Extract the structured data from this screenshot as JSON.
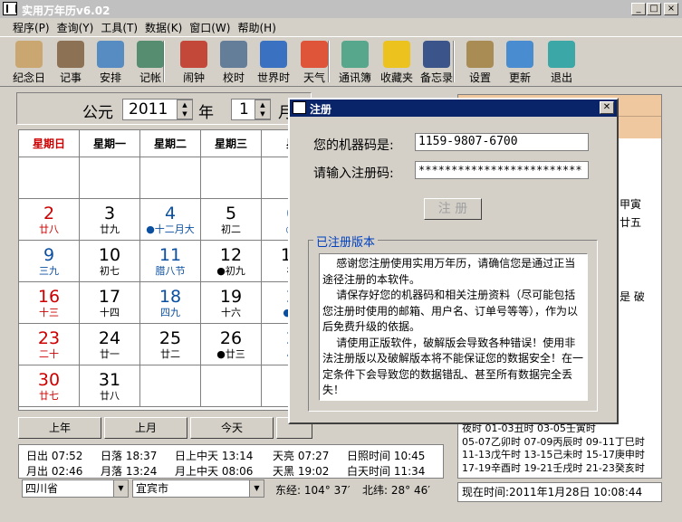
{
  "window": {
    "title": "实用万年历v6.02",
    "min": "_",
    "max": "□",
    "close": "×"
  },
  "menu": [
    "程序(P)",
    "查询(Y)",
    "工具(T)",
    "数据(K)",
    "窗口(W)",
    "帮助(H)"
  ],
  "toolbar": [
    {
      "label": "纪念日",
      "icon": "memorial-icon",
      "color": "#c8a060"
    },
    {
      "label": "记事",
      "icon": "notes-icon",
      "color": "#806040"
    },
    {
      "label": "安排",
      "icon": "schedule-icon",
      "color": "#4080c0"
    },
    {
      "label": "记帐",
      "icon": "ledger-icon",
      "color": "#408060"
    },
    {
      "label": "闹钟",
      "icon": "alarm-clock-icon",
      "color": "#c03020"
    },
    {
      "label": "校时",
      "icon": "time-sync-icon",
      "color": "#507090"
    },
    {
      "label": "世界时",
      "icon": "globe-icon",
      "color": "#2060c0"
    },
    {
      "label": "天气",
      "icon": "weather-icon",
      "color": "#e04020"
    },
    {
      "label": "通讯簿",
      "icon": "addressbook-icon",
      "color": "#40a080"
    },
    {
      "label": "收藏夹",
      "icon": "star-icon",
      "color": "#f0c000"
    },
    {
      "label": "备忘录",
      "icon": "memo-icon",
      "color": "#204080"
    },
    {
      "label": "设置",
      "icon": "settings-icon",
      "color": "#a08040"
    },
    {
      "label": "更新",
      "icon": "update-icon",
      "color": "#3080d0"
    },
    {
      "label": "退出",
      "icon": "exit-icon",
      "color": "#20a0a0"
    }
  ],
  "selector": {
    "era": "公元",
    "year": "2011",
    "year_unit": "年",
    "month": "1",
    "month_unit": "月"
  },
  "weekdays": [
    "星期日",
    "星期一",
    "星期二",
    "星期三",
    "星"
  ],
  "calendar": [
    [
      {
        "d": "",
        "l": ""
      },
      {
        "d": "",
        "l": ""
      },
      {
        "d": "",
        "l": ""
      },
      {
        "d": "",
        "l": ""
      },
      {
        "d": "",
        "l": ""
      }
    ],
    [
      {
        "d": "2",
        "l": "廿八",
        "c": "red"
      },
      {
        "d": "3",
        "l": "廿九"
      },
      {
        "d": "4",
        "l": "●十二月大",
        "c": "blue"
      },
      {
        "d": "5",
        "l": "初二"
      },
      {
        "d": "6",
        "l": "◎·",
        "c": "blue"
      }
    ],
    [
      {
        "d": "9",
        "l": "三九",
        "c": "blue"
      },
      {
        "d": "10",
        "l": "初七"
      },
      {
        "d": "11",
        "l": "腊八节",
        "c": "blue"
      },
      {
        "d": "12",
        "l": "●初九"
      },
      {
        "d": "13",
        "l": "初"
      }
    ],
    [
      {
        "d": "16",
        "l": "十三",
        "c": "red"
      },
      {
        "d": "17",
        "l": "十四"
      },
      {
        "d": "18",
        "l": "四九",
        "c": "blue"
      },
      {
        "d": "19",
        "l": "十六"
      },
      {
        "d": "2",
        "l": "●◎",
        "c": "blue"
      }
    ],
    [
      {
        "d": "23",
        "l": "二十",
        "c": "red"
      },
      {
        "d": "24",
        "l": "廿一"
      },
      {
        "d": "25",
        "l": "廿二"
      },
      {
        "d": "26",
        "l": "●廿三"
      },
      {
        "d": "2",
        "l": "小",
        "c": "blue"
      }
    ],
    [
      {
        "d": "30",
        "l": "廿七",
        "c": "red"
      },
      {
        "d": "31",
        "l": "廿八"
      },
      {
        "d": "",
        "l": ""
      },
      {
        "d": "",
        "l": ""
      },
      {
        "d": "",
        "l": ""
      }
    ]
  ],
  "nav": [
    "上年",
    "上月",
    "今天"
  ],
  "sun": {
    "rise": "日出 07:52",
    "set": "日落 18:37",
    "noon": "日上中天 13:14",
    "dawn": "天亮 07:27",
    "daylight": "日照时间 10:45"
  },
  "moon": {
    "rise": "月出 02:46",
    "set": "月落 13:24",
    "noon": "月上中天 08:06",
    "dusk": "天黑 19:02",
    "night": "白天时间 11:34"
  },
  "location": {
    "province": "四川省",
    "city": "宜宾市",
    "longitude": "东经: 104° 37′",
    "latitude": "北纬: 28° 46′"
  },
  "right_panel": {
    "frag1": "甲寅",
    "frag2": "廿五",
    "frag3": "是 破",
    "hours": [
      "夜时 01-03丑时 03-05壬寅时",
      "05-07乙卯时 07-09丙辰时 09-11丁巳时",
      "11-13戊午时 13-15己未时 15-17庚申时",
      "17-19辛酉时 19-21壬戌时 21-23癸亥时"
    ],
    "now": "现在时间:2011年1月28日  10:08:44"
  },
  "dialog": {
    "title": "注册",
    "machine_label": "您的机器码是:",
    "machine_code": "1159-9807-6700",
    "reg_label": "请输入注册码:",
    "reg_code": "*************************",
    "register_button": "注  册",
    "group_title": "已注册版本",
    "memo": "    感谢您注册使用实用万年历，请确信您是通过正当途径注册的本软件。\n    请保存好您的机器码和相关注册资料（尽可能包括您注册时使用的邮箱、用户名、订单号等等），作为以后免费升级的依据。\n    请使用正版软件，破解版会导致各种错误！使用非法注册版以及破解版本将不能保证您的数据安全！在一定条件下会导致您的数据错乱、甚至所有数据完全丢失！"
  }
}
